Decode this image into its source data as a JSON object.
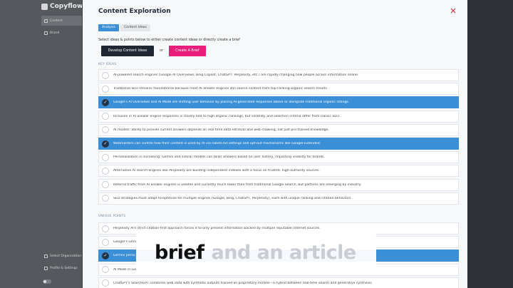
{
  "app": {
    "logo": "Copyflow",
    "sidebar_items": [
      "Content",
      "Brand"
    ],
    "sidebar_bottom": [
      "Select Organization",
      "Profile & Settings"
    ]
  },
  "modal": {
    "title": "Content Exploration",
    "close_icon": "close-x-icon",
    "tabs": [
      {
        "label": "Analysis",
        "active": true
      },
      {
        "label": "Content Ideas",
        "active": false
      }
    ],
    "instruction": "Select ideas & points below to either create content ideas or directly create a brief",
    "develop_button": "Develop Content Ideas",
    "or_text": "or",
    "brief_button": "Create A Brief",
    "key_ideas_label": "KEY IDEAS",
    "unique_points_label": "UNIQUE POINTS"
  },
  "key_ideas": [
    {
      "text": "AI-powered search engines (Google AI Overviews, Bing Copilot, ChatGPT, Perplexity, etc.) are rapidly changing how people access information online.",
      "selected": false
    },
    {
      "text": "Traditional SEO remains foundational because most AI answer engines still source content from top-ranking organic search results.",
      "selected": false
    },
    {
      "text": "Google's AI Overviews and AI Mode are shifting user behavior by placing AI-generated responses above or alongside traditional organic listings.",
      "selected": true
    },
    {
      "text": "Inclusion in AI answer engine responses is closely tied to high organic rankings, but volatility and selection criteria differ from classic SEO.",
      "selected": false
    },
    {
      "text": "AI models' ability to provide current answers depends on real-time data retrieval and web crawling, not just pre-trained knowledge.",
      "selected": false
    },
    {
      "text": "Webmasters can control how their content is used by AI via robots.txt settings and opt-out mechanisms like Google-Extended.",
      "selected": true
    },
    {
      "text": "Personalization is increasing: Gemini and similar models can tailor answers based on user history, impacting visibility for brands.",
      "selected": false
    },
    {
      "text": "Alternative AI search engines like Perplexity are building independent indexes with a focus on trusted, high-authority sources.",
      "selected": false
    },
    {
      "text": "Referral traffic from AI answer engines is volatile and currently much lower than from traditional Google Search, but patterns are emerging by industry.",
      "selected": false
    },
    {
      "text": "SEO strategies must adapt to optimize for multiple engines (Google, Bing, ChatGPT, Perplexity), each with unique ranking and citation behaviors.",
      "selected": false
    }
  ],
  "unique_points": [
    {
      "text": "Perplexity AI's strict citation-first approach forces it to only present information backed by multiple reputable internet sources.",
      "selected": false
    },
    {
      "text": "Google's Gemi",
      "selected": false
    },
    {
      "text": "Gemini perso",
      "selected": true
    },
    {
      "text": "AI Mode in Go",
      "selected": false
    },
    {
      "text": "ChatGPT's SearchGPT combines web data with synthetic outputs trained on proprietary models—a hybrid between real-time search and generative synthesis.",
      "selected": false
    }
  ],
  "caption": {
    "strong": "brief",
    "faint": "and an article"
  }
}
